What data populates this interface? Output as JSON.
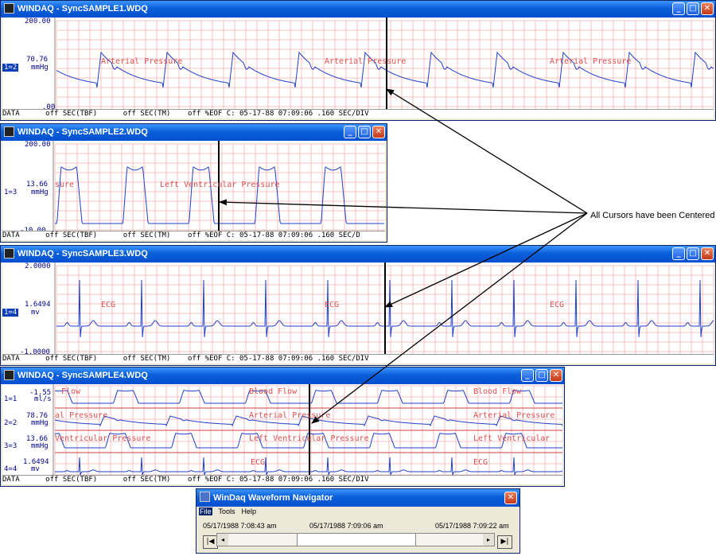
{
  "annotation": "All Cursors have been Centered",
  "windows": [
    {
      "title": "WINDAQ - SyncSAMPLE1.WDQ",
      "channels": [
        {
          "top": "200.00",
          "value": "70.76",
          "unit": "mmHg",
          "id": "1=2",
          "bottom": ".00",
          "active": true,
          "labels": [
            "Arterial Pressure",
            "Arterial Pressure",
            "Arterial Pressure"
          ]
        }
      ],
      "status": "DATA      off SEC(TBF)      off SEC(TM)    off %EOF C: 05-17-88 07:09:06 .160 SEC/DIV"
    },
    {
      "title": "WINDAQ - SyncSAMPLE2.WDQ",
      "channels": [
        {
          "top": "200.00",
          "value": "13.66",
          "unit": "mmHg",
          "id": "1=3",
          "bottom": "-10.00",
          "active": false,
          "labels": [
            "sure",
            "Left Ventricular Pressure"
          ]
        }
      ],
      "status": "DATA      off SEC(TBF)      off SEC(TM)    off %EOF C: 05-17-88 07:09:06 .160 SEC/D"
    },
    {
      "title": "WINDAQ - SyncSAMPLE3.WDQ",
      "channels": [
        {
          "top": "2.0000",
          "value": "1.6494",
          "unit": "mv",
          "id": "1=4",
          "bottom": "-1.0000",
          "active": true,
          "labels": [
            "ECG",
            "ECG",
            "ECG"
          ]
        }
      ],
      "status": "DATA      off SEC(TBF)      off SEC(TM)    off %EOF C: 05-17-88 07:09:06 .160 SEC/DIV"
    },
    {
      "title": "WINDAQ - SyncSAMPLE4.WDQ",
      "channels": [
        {
          "value": "-1.55",
          "unit": "ml/s",
          "id": "1=1",
          "labels": [
            "Flow",
            "Blood Flow",
            "Blood Flow"
          ]
        },
        {
          "value": "78.76",
          "unit": "mmHg",
          "id": "2=2",
          "labels": [
            "al Pressure",
            "Arterial Pressure",
            "Arterial Pressure"
          ]
        },
        {
          "value": "13.66",
          "unit": "mmHg",
          "id": "3=3",
          "labels": [
            "Ventricular Pressure",
            "Left Ventricular Pressure",
            "Left Ventricular"
          ]
        },
        {
          "value": "1.6494",
          "unit": "mv",
          "id": "4=4",
          "labels": [
            "ECG",
            "ECG"
          ]
        }
      ],
      "status": "DATA      off SEC(TBF)      off SEC(TM)    off %EOF C: 05-17-88 07:09:06 .160 SEC/DIV"
    }
  ],
  "navigator": {
    "title": "WinDaq Waveform Navigator",
    "menu": [
      "File",
      "Tools",
      "Help"
    ],
    "time_start": "05/17/1988 7:08:43 am",
    "time_cursor": "05/17/1988 7:09:06 am",
    "time_end": "05/17/1988 7:09:22 am",
    "first_button": "|◀",
    "last_button": "▶|",
    "scroll_left": "◂",
    "scroll_right": "▸",
    "thumb_position": 0.5
  },
  "colors": {
    "titlebar": "#0a5fd8",
    "grid": "#f4b0b0",
    "waveform": "#2040c8",
    "cursor": "#000000",
    "label": "#e05050"
  },
  "icons": {
    "window": "windaq-app-icon",
    "minimize": "minimize-icon",
    "maximize": "maximize-icon",
    "close": "close-icon"
  }
}
